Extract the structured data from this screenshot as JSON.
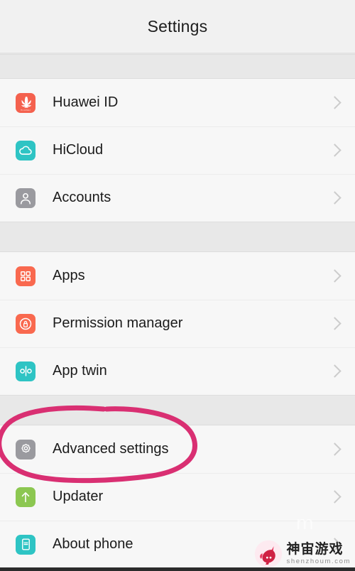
{
  "header": {
    "title": "Settings"
  },
  "colors": {
    "page_background": "#f6f6f6",
    "list_background": "#f7f7f7",
    "band_background": "#e8e8e8",
    "divider": "#ececec",
    "label_text": "#1b1b1b",
    "chevron": "#cccccc",
    "annotation_pink": "#d92f72",
    "huawei_red": "#f4614e",
    "teal": "#2ec4c4",
    "gray_icon": "#9a9a9f",
    "orange": "#f9694f",
    "green": "#8cc751"
  },
  "groups": [
    {
      "items": [
        {
          "label": "Huawei ID",
          "icon": "huawei-logo-icon",
          "icon_class": "ico-huawei",
          "chevron": true,
          "highlighted": false
        },
        {
          "label": "HiCloud",
          "icon": "cloud-icon",
          "icon_class": "ico-hicloud",
          "chevron": true,
          "highlighted": false
        },
        {
          "label": "Accounts",
          "icon": "person-icon",
          "icon_class": "ico-accounts",
          "chevron": true,
          "highlighted": false
        }
      ]
    },
    {
      "items": [
        {
          "label": "Apps",
          "icon": "grid-squares-icon",
          "icon_class": "ico-apps",
          "chevron": true,
          "highlighted": false
        },
        {
          "label": "Permission manager",
          "icon": "lock-in-circle-icon",
          "icon_class": "ico-perm",
          "chevron": true,
          "highlighted": false
        },
        {
          "label": "App twin",
          "icon": "app-twin-split-icon",
          "icon_class": "ico-twin",
          "chevron": true,
          "highlighted": false
        }
      ]
    },
    {
      "items": [
        {
          "label": "Advanced settings",
          "icon": "gear-icon",
          "icon_class": "ico-adv",
          "chevron": true,
          "highlighted": true
        },
        {
          "label": "Updater",
          "icon": "up-arrow-icon",
          "icon_class": "ico-updater",
          "chevron": true,
          "highlighted": false
        },
        {
          "label": "About phone",
          "icon": "phone-device-icon",
          "icon_class": "ico-about",
          "chevron": true,
          "highlighted": false
        }
      ]
    }
  ],
  "annotation": {
    "shape": "hand-drawn-ellipse",
    "target": "Advanced settings",
    "color": "#d92f72",
    "stroke_width": 7
  },
  "watermark": {
    "brand_cn": "神宙游戏",
    "url": "shenzhoum.com",
    "logo": "unicorn-head-logo",
    "ghost_glyph": "m"
  },
  "huawei_icon": {
    "wordmark": "HUAWEI"
  }
}
